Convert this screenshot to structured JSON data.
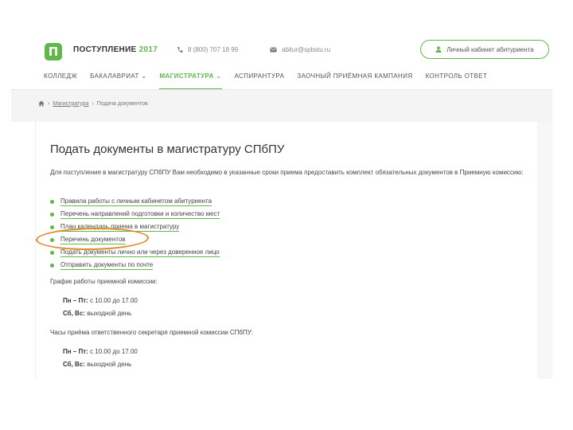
{
  "header": {
    "brand_name": "ПОСТУПЛЕНИЕ",
    "brand_year": "2017",
    "phone": "8 (800) 707 18 99",
    "email": "abitur@spbstu.ru",
    "cabinet_button": "Личный кабинет абитуриента",
    "logo_text": "П"
  },
  "nav": {
    "items": [
      {
        "label": "КОЛЛЕДЖ"
      },
      {
        "label": "БАКАЛАВРИАТ ⌄"
      },
      {
        "label": "МАГИСТРАТУРА ⌄"
      },
      {
        "label": "АСПИРАНТУРА"
      },
      {
        "label": "ЗАОЧНЫЙ ПРИЁМНАЯ КАМПАНИЯ"
      },
      {
        "label": "КОНТРОЛЬ ОТВЕТ"
      }
    ]
  },
  "breadcrumb": {
    "item1": "Магистратура",
    "item2": "Подача документов"
  },
  "main": {
    "title": "Подать документы в магистратуру СПбПУ",
    "intro": "Для поступления в магистратуру СПбПУ Вам необходимо в указанные сроки приема предоставить комплект обязательных документов в Приемную комиссию:",
    "links": [
      {
        "label": "Правила работы с личным кабинетом абитуриента"
      },
      {
        "label": "Перечень направлений подготовки и количество мест"
      },
      {
        "label": "План календарь приема в магистратуру"
      },
      {
        "label": "Перечень документов"
      },
      {
        "label": "Подать документы лично или через доверенное лицо"
      },
      {
        "label": "Отправить документы по почте"
      }
    ],
    "schedule1": {
      "heading": "График работы приемной комиссии:",
      "line1_days": "Пн – Пт:",
      "line1_time": "с 10.00 до 17.00",
      "line2_days": "Сб, Вс:",
      "line2_time": "выходной день"
    },
    "schedule2": {
      "heading": "Часы приёма ответственного секретаря приемной комиссии СПбПУ:",
      "line1_days": "Пн – Пт:",
      "line1_time": "с 10.00 до 17.00",
      "line2_days": "Сб, Вс:",
      "line2_time": "выходной день"
    }
  },
  "colors": {
    "accent": "#5fb84a",
    "highlight": "#e08a2a"
  },
  "icons": [
    "logo-icon",
    "phone-icon",
    "mail-icon",
    "user-icon",
    "home-icon"
  ]
}
